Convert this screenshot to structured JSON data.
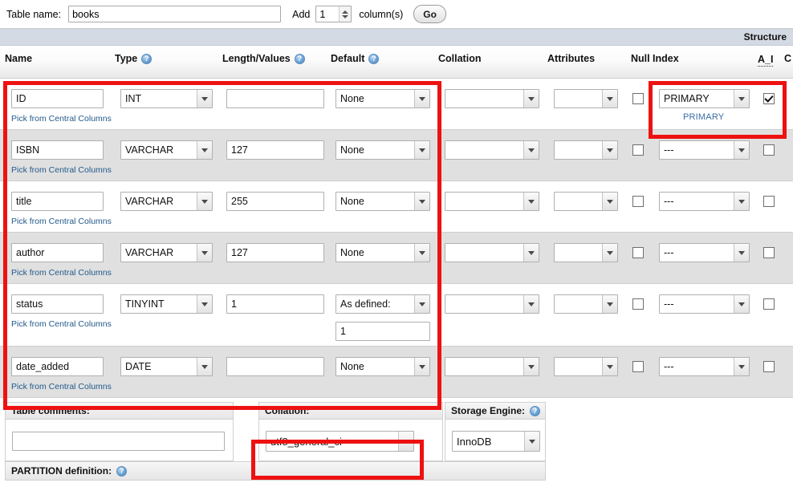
{
  "toolbar": {
    "table_name_label": "Table name:",
    "table_name_value": "books",
    "add_label": "Add",
    "add_count": "1",
    "columns_label": "column(s)",
    "go_label": "Go"
  },
  "structure_band": {
    "label": "Structure"
  },
  "grid": {
    "headers": {
      "name": "Name",
      "type": "Type",
      "length": "Length/Values",
      "default": "Default",
      "collation": "Collation",
      "attributes": "Attributes",
      "null": "Null",
      "index": "Index",
      "a_i": "A_I",
      "comments": "C"
    },
    "central_columns_link": "Pick from Central Columns",
    "primary_note": "PRIMARY",
    "rows": [
      {
        "name": "ID",
        "type": "INT",
        "length": "",
        "default": "None",
        "default_extra": "",
        "collation": "",
        "attributes": "",
        "null": false,
        "index": "PRIMARY",
        "a_i": true,
        "link": "Pick from Central Columns"
      },
      {
        "name": "ISBN",
        "type": "VARCHAR",
        "length": "127",
        "default": "None",
        "default_extra": "",
        "collation": "",
        "attributes": "",
        "null": false,
        "index": "---",
        "a_i": false,
        "link": "Pick from Central Columns"
      },
      {
        "name": "title",
        "type": "VARCHAR",
        "length": "255",
        "default": "None",
        "default_extra": "",
        "collation": "",
        "attributes": "",
        "null": false,
        "index": "---",
        "a_i": false,
        "link": "Pick from Central Columns"
      },
      {
        "name": "author",
        "type": "VARCHAR",
        "length": "127",
        "default": "None",
        "default_extra": "",
        "collation": "",
        "attributes": "",
        "null": false,
        "index": "---",
        "a_i": false,
        "link": "Pick from Central Columns"
      },
      {
        "name": "status",
        "type": "TINYINT",
        "length": "1",
        "default": "As defined:",
        "default_extra": "1",
        "collation": "",
        "attributes": "",
        "null": false,
        "index": "---",
        "a_i": false,
        "link": "Pick from Central Columns"
      },
      {
        "name": "date_added",
        "type": "DATE",
        "length": "",
        "default": "None",
        "default_extra": "",
        "collation": "",
        "attributes": "",
        "null": false,
        "index": "---",
        "a_i": false,
        "link": "Pick from Central Columns"
      }
    ]
  },
  "bottom": {
    "table_comments_label": "Table comments:",
    "table_comments_value": "",
    "collation_label": "Collation:",
    "collation_value": "utf8_general_ci",
    "storage_engine_label": "Storage Engine:",
    "storage_engine_value": "InnoDB",
    "partition_label": "PARTITION definition:"
  },
  "icons": {
    "help": "help-icon",
    "dropdown": "chevron-down-icon",
    "spinner_up": "spinner-up-icon",
    "spinner_down": "spinner-down-icon"
  },
  "annotations": {
    "highlight_color": "#ee1111",
    "boxes": [
      "columns-definition-area",
      "primary-index-area",
      "collation-area"
    ]
  }
}
